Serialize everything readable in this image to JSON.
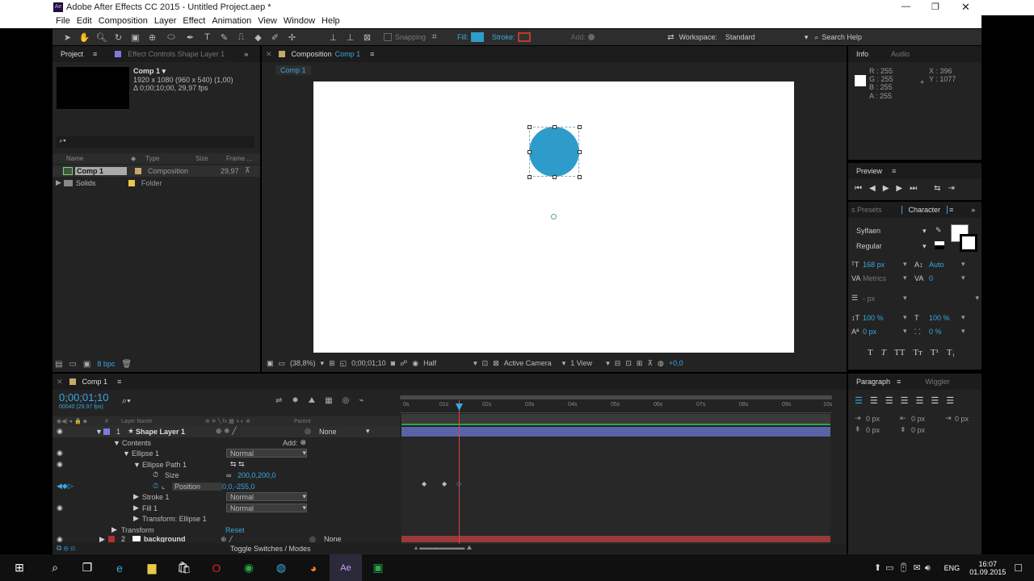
{
  "window": {
    "title": "Adobe After Effects CC 2015 - Untitled Project.aep *",
    "app_badge": "Ae",
    "minimize": "—",
    "maximize": "❐",
    "close": "✕"
  },
  "menu": [
    "File",
    "Edit",
    "Composition",
    "Layer",
    "Effect",
    "Animation",
    "View",
    "Window",
    "Help"
  ],
  "toolbar": {
    "snapping": "Snapping",
    "fill": "Fill:",
    "stroke": "Stroke:",
    "add": "Add:",
    "workspace_label": "Workspace:",
    "workspace_value": "Standard",
    "search": "Search Help",
    "fill_color": "#2e9ccb",
    "stroke_color": "#c0392b"
  },
  "project": {
    "tab": "Project",
    "effect_tab": "Effect Controls Shape Layer 1",
    "comp_name": "Comp 1 ▾",
    "comp_info1": "1920 x 1080  (960 x 540) (1,00)",
    "comp_info2": "Δ 0;00;10;00, 29,97 fps",
    "columns": {
      "name": "Name",
      "type": "Type",
      "size": "Size",
      "frame": "Frame ..."
    },
    "items": [
      {
        "name": "Comp 1",
        "type": "Composition",
        "frame": "29,97",
        "color": "#c9a96b"
      },
      {
        "name": "Solids",
        "type": "Folder",
        "frame": "",
        "color": "#e8c84b"
      }
    ],
    "bpc": "8 bpc"
  },
  "composition": {
    "tab": "Composition",
    "tab_name": "Comp 1",
    "subtab": "Comp 1",
    "zoom": "(38,8%)",
    "timecode": "0;00;01;10",
    "resolution": "Half",
    "camera": "Active Camera",
    "views": "1 View",
    "exposure": "+0,0",
    "circle_color": "#2e9ccb"
  },
  "info": {
    "tab": "Info",
    "tab2": "Audio",
    "r": "R : 255",
    "g": "G : 255",
    "b": "B : 255",
    "a": "A : 255",
    "x": "X : 396",
    "y": "Y : 1077"
  },
  "preview": {
    "tab": "Preview"
  },
  "character": {
    "tab_left": "s Presets",
    "tab": "Character",
    "font": "Sylfaen",
    "style": "Regular",
    "size": "168 px",
    "leading": "Auto",
    "kerning": "Metrics",
    "tracking": "0",
    "stroke_w": "- px",
    "vscale": "100 %",
    "hscale": "100 %",
    "baseline": "0 px",
    "tsume": "0 %"
  },
  "paragraph": {
    "tab": "Paragraph",
    "tab2": "Wiggler",
    "indent1": "0 px",
    "indent2": "0 px",
    "indent3": "0 px",
    "space1": "0 px",
    "space2": "0 px"
  },
  "timeline": {
    "tab": "Comp 1",
    "timecode": "0;00;01;10",
    "fps": "00040 (29.97 fps)",
    "col_layer": "Layer Name",
    "col_parent": "Parent",
    "toggle": "Toggle Switches / Modes",
    "ruler": [
      "0s",
      "01s",
      "02s",
      "03s",
      "04s",
      "05s",
      "06s",
      "07s",
      "08s",
      "09s",
      "10s"
    ],
    "layers": [
      {
        "num": "1",
        "name": "Shape Layer 1",
        "parent": "None"
      },
      {
        "name": "Contents",
        "add": "Add:"
      },
      {
        "name": "Ellipse 1",
        "mode": "Normal"
      },
      {
        "name": "Ellipse Path 1"
      },
      {
        "name": "Size",
        "value": "200,0,200,0"
      },
      {
        "name": "Position",
        "value": "0,0,-255,0"
      },
      {
        "name": "Stroke 1",
        "mode": "Normal"
      },
      {
        "name": "Fill 1",
        "mode": "Normal"
      },
      {
        "name": "Transform: Ellipse 1"
      },
      {
        "name": "Transform",
        "value": "Reset"
      },
      {
        "num": "2",
        "name": "background",
        "parent": "None"
      }
    ]
  },
  "taskbar": {
    "lang": "ENG",
    "time": "16:07",
    "date": "01.09.2015"
  }
}
